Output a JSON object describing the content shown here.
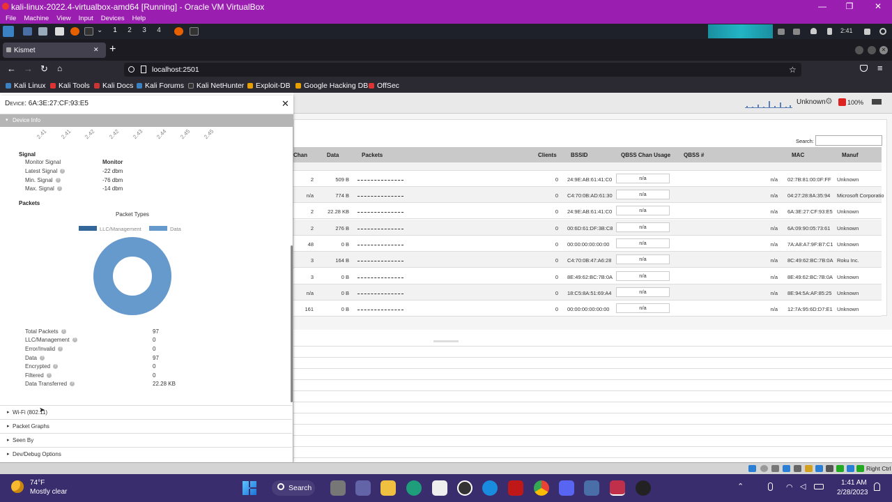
{
  "window": {
    "title": "kali-linux-2022.4-virtualbox-amd64 [Running] - Oracle VM VirtualBox",
    "menu": [
      "File",
      "Machine",
      "View",
      "Input",
      "Devices",
      "Help"
    ]
  },
  "kali": {
    "workspaces": [
      "1",
      "2",
      "3",
      "4"
    ],
    "clock": "2:41"
  },
  "browser": {
    "tab_title": "Kismet",
    "url": "localhost:2501",
    "bookmarks": [
      "Kali Linux",
      "Kali Tools",
      "Kali Docs",
      "Kali Forums",
      "Kali NetHunter",
      "Exploit-DB",
      "Google Hacking DB",
      "OffSec"
    ]
  },
  "kismet": {
    "status_source": "Unknown",
    "battery": "100%",
    "search_label": "Search:",
    "columns": [
      "Chan",
      "Data",
      "Packets",
      "Clients",
      "BSSID",
      "QBSS Chan Usage",
      "QBSS #",
      "MAC",
      "Manuf"
    ],
    "rows": [
      {
        "chan": "2",
        "data": "509 B",
        "clients": "0",
        "bssid": "24:9E:AB:61:41:C0",
        "qbss": "n/a",
        "qbssn": "n/a",
        "mac": "02:7B:81:00:0F:FF",
        "manuf": "Unknown"
      },
      {
        "chan": "n/a",
        "data": "774 B",
        "clients": "0",
        "bssid": "C4:70:0B:AD:61:30",
        "qbss": "n/a",
        "qbssn": "n/a",
        "mac": "04:27:28:8A:35:94",
        "manuf": "Microsoft Corporatio"
      },
      {
        "chan": "2",
        "data": "22.28 KB",
        "clients": "0",
        "bssid": "24:9E:AB:61:41:C0",
        "qbss": "n/a",
        "qbssn": "n/a",
        "mac": "6A:3E:27:CF:93:E5",
        "manuf": "Unknown"
      },
      {
        "chan": "2",
        "data": "276 B",
        "clients": "0",
        "bssid": "00:6D:61:DF:3B:C8",
        "qbss": "n/a",
        "qbssn": "n/a",
        "mac": "6A:09:90:05:73:61",
        "manuf": "Unknown"
      },
      {
        "chan": "48",
        "data": "0 B",
        "clients": "0",
        "bssid": "00:00:00:00:00:00",
        "qbss": "n/a",
        "qbssn": "n/a",
        "mac": "7A:A8:A7:9F:B7:C1",
        "manuf": "Unknown"
      },
      {
        "chan": "3",
        "data": "164 B",
        "clients": "0",
        "bssid": "C4:70:0B:47:A6:28",
        "qbss": "n/a",
        "qbssn": "n/a",
        "mac": "8C:49:62:BC:7B:0A",
        "manuf": "Roku Inc."
      },
      {
        "chan": "3",
        "data": "0 B",
        "clients": "0",
        "bssid": "8E:49:62:BC:7B:0A",
        "qbss": "n/a",
        "qbssn": "n/a",
        "mac": "8E:49:62:BC:7B:0A",
        "manuf": "Unknown"
      },
      {
        "chan": "n/a",
        "data": "0 B",
        "clients": "0",
        "bssid": "18:C5:8A:51:69:A4",
        "qbss": "n/a",
        "qbssn": "n/a",
        "mac": "8E:94:5A:AF:85:25",
        "manuf": "Unknown"
      },
      {
        "chan": "161",
        "data": "0 B",
        "clients": "0",
        "bssid": "00:00:00:00:00:00",
        "qbss": "n/a",
        "qbssn": "n/a",
        "mac": "12:7A:95:6D:D7:E1",
        "manuf": "Unknown"
      }
    ]
  },
  "panel": {
    "title_prefix": "Device",
    "device": "6A:3E:27:CF:93:E5",
    "section": "Device Info",
    "freq_ticks": [
      "2.41",
      "2.41",
      "2.42",
      "2.42",
      "2.43",
      "2.44",
      "2.45",
      "2.45"
    ],
    "signal": {
      "header": "Signal",
      "rows": [
        {
          "label": "Monitor Signal",
          "value": "Monitor"
        },
        {
          "label": "Latest Signal",
          "value": "-22 dbm"
        },
        {
          "label": "Min. Signal",
          "value": "-76 dbm"
        },
        {
          "label": "Max. Signal",
          "value": "-14 dbm"
        }
      ]
    },
    "packets_header": "Packets",
    "chart_data": {
      "type": "pie",
      "title": "Packet Types",
      "categories": [
        "LLC/Management",
        "Data"
      ],
      "values": [
        0,
        97
      ],
      "colors": [
        "#336699",
        "#6699cc"
      ]
    },
    "stats": [
      {
        "label": "Total Packets",
        "value": "97"
      },
      {
        "label": "LLC/Management",
        "value": "0"
      },
      {
        "label": "Error/Invalid",
        "value": "0"
      },
      {
        "label": "Data",
        "value": "97"
      },
      {
        "label": "Encrypted",
        "value": "0"
      },
      {
        "label": "Filtered",
        "value": "0"
      },
      {
        "label": "Data Transferred",
        "value": "22.28 KB"
      }
    ],
    "sections": [
      "Wi-Fi (802.11)",
      "Packet Graphs",
      "Seen By",
      "Dev/Debug Options"
    ]
  },
  "vbox_status": {
    "host_key": "Right Ctrl"
  },
  "taskbar": {
    "temp": "74°F",
    "weather": "Mostly clear",
    "search": "Search",
    "time": "1:41 AM",
    "date": "2/28/2023"
  }
}
